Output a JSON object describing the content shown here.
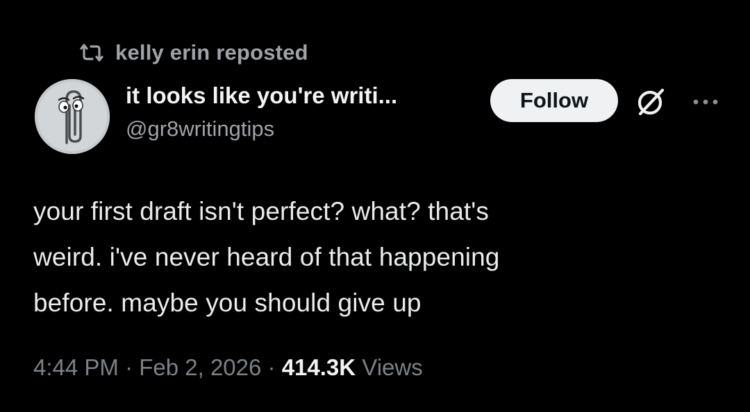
{
  "repost": {
    "label": "kelly erin reposted",
    "icon": "repost-icon"
  },
  "author": {
    "display_name": "it looks like you're writi...",
    "handle": "@gr8writingtips",
    "avatar_icon": "paperclip-avatar"
  },
  "actions": {
    "follow_label": "Follow",
    "grok_icon": "grok-icon",
    "more_icon": "more-icon"
  },
  "post": {
    "text": "your first draft isn't perfect? what? that's\nweird. i've never heard of that happening\nbefore. maybe you should give up"
  },
  "meta": {
    "time": "4:44 PM",
    "separator_1": " · ",
    "date": "Feb 2, 2026",
    "separator_2": " · ",
    "views_count": "414.3K",
    "views_label": "Views"
  },
  "colors": {
    "background": "#000000",
    "text_primary": "#e9ebec",
    "text_secondary": "#9fa3a7",
    "follow_button_bg": "#eff1f2",
    "follow_button_text": "#0f1419"
  }
}
